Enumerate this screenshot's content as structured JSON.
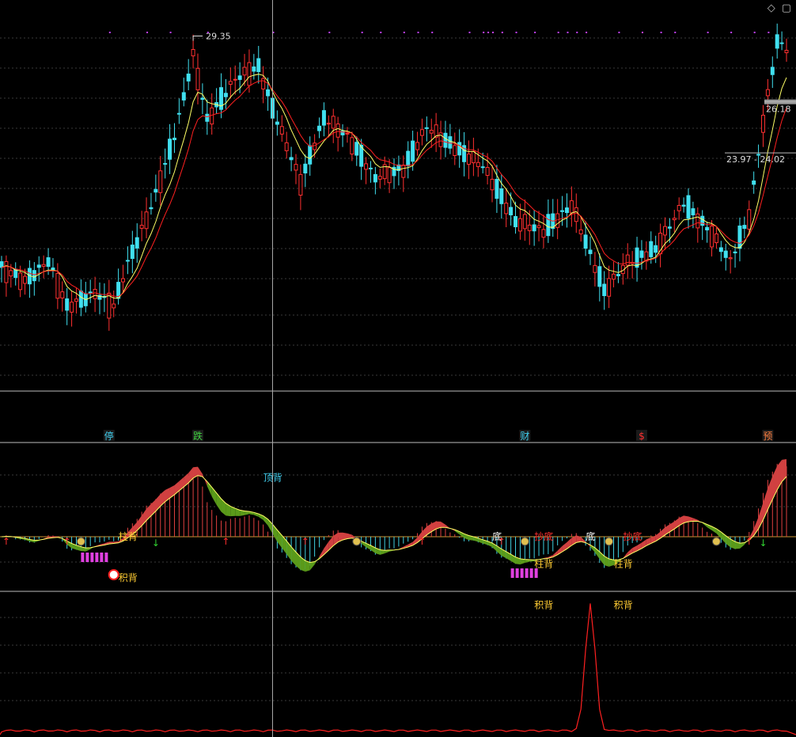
{
  "chart_data": [
    {
      "type": "candlestick",
      "panel": "price",
      "ylim": [
        14,
        30.5
      ],
      "n": 169,
      "high_label": "29.35",
      "price_labels": [
        {
          "text": "26.18",
          "y": 26.18
        },
        {
          "text": "23.97 - 24.02",
          "y": 24.0
        }
      ],
      "series": [
        {
          "name": "",
          "color": "#ffff66"
        },
        {
          "name": "",
          "color": "#ff2020"
        }
      ],
      "colors": {
        "up": "#ff3030",
        "down": "#40e0f0"
      }
    },
    {
      "type": "events",
      "panel": "event-strip",
      "events": [
        {
          "i": 23,
          "text": "停",
          "color": "#40d0f0"
        },
        {
          "i": 42,
          "text": "跌",
          "color": "#40d040"
        },
        {
          "i": 112,
          "text": "财",
          "color": "#40d0f0"
        },
        {
          "i": 137,
          "text": "$",
          "color": "#ff3030"
        },
        {
          "i": 164,
          "text": "预",
          "color": "#ff8040"
        }
      ]
    },
    {
      "type": "bar",
      "panel": "macd",
      "ylim": [
        -1,
        1
      ],
      "annotations": [
        {
          "i": 24,
          "text": "柱背",
          "color": "#ffcc33",
          "level": 0.0
        },
        {
          "i": 24,
          "text": "积背",
          "color": "#ffcc33",
          "level": -0.45
        },
        {
          "i": 55,
          "text": "顶背",
          "color": "#40d0f0",
          "level": 0.65
        },
        {
          "i": 104,
          "text": "底",
          "color": "#ffffff",
          "level": 0.0
        },
        {
          "i": 113,
          "text": "抄底",
          "color": "#ff3030",
          "level": 0.0
        },
        {
          "i": 113,
          "text": "柱背",
          "color": "#ffcc33",
          "level": -0.3
        },
        {
          "i": 113,
          "text": "积背",
          "color": "#ffcc33",
          "level": -0.75
        },
        {
          "i": 124,
          "text": "底",
          "color": "#ffffff",
          "level": 0.0
        },
        {
          "i": 132,
          "text": "抄底",
          "color": "#ff3030",
          "level": 0.0
        },
        {
          "i": 130,
          "text": "柱背",
          "color": "#ffcc33",
          "level": -0.3
        },
        {
          "i": 130,
          "text": "积背",
          "color": "#ffcc33",
          "level": -0.75
        }
      ],
      "colors": {
        "pos": "#e04040",
        "neg": "#40d0e0",
        "fill_up": "#d04040",
        "fill_dn": "#5a9a1a"
      }
    },
    {
      "type": "area",
      "panel": "volume-indicator",
      "ylim": [
        0,
        1
      ],
      "peak_index": 126,
      "color": "#ff2020"
    }
  ],
  "icons": {
    "corner": [
      "diamond-icon",
      "window-icon"
    ]
  }
}
